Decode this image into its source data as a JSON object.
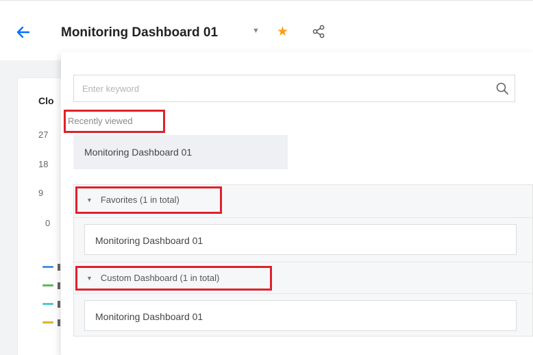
{
  "header": {
    "title": "Monitoring Dashboard 01",
    "caret": "▼",
    "star": "★"
  },
  "background_card": {
    "title": "Clo",
    "ticks": [
      "27",
      "18",
      "9",
      "0"
    ],
    "legend_colors": [
      "#4a90e2",
      "#5bb85d",
      "#4dc9d3",
      "#d8b52a"
    ]
  },
  "dropdown": {
    "search": {
      "placeholder": "Enter keyword",
      "value": ""
    },
    "recent": {
      "label": "Recently viewed",
      "items": [
        "Monitoring Dashboard 01"
      ]
    },
    "groups": [
      {
        "label": "Favorites  (1 in total)",
        "items": [
          "Monitoring Dashboard 01"
        ]
      },
      {
        "label": "Custom Dashboard  (1 in total)",
        "items": [
          "Monitoring Dashboard 01"
        ]
      }
    ]
  },
  "colors": {
    "accent": "#006eff",
    "star": "#ff9c19",
    "highlight": "#e0212c"
  }
}
